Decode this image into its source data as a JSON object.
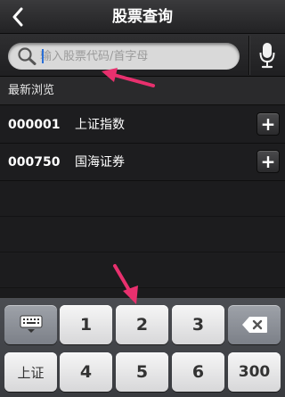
{
  "header": {
    "title": "股票查询",
    "back_icon": "chevron-left-icon"
  },
  "search": {
    "placeholder": "输入股票代码/首字母",
    "value": "",
    "search_icon": "magnifier-icon",
    "voice_icon": "microphone-icon"
  },
  "recent": {
    "section_label": "最新浏览",
    "items": [
      {
        "code": "000001",
        "name": "上证指数",
        "action_label": "+"
      },
      {
        "code": "000750",
        "name": "国海证券",
        "action_label": "+"
      }
    ]
  },
  "keyboard": {
    "row1": {
      "hide_key_icon": "keyboard-hide-icon",
      "k1": "1",
      "k2": "2",
      "k3": "3",
      "backspace_icon": "backspace-icon"
    },
    "row2": {
      "market_key": "上证",
      "k4": "4",
      "k5": "5",
      "k6": "6",
      "k300": "300"
    }
  },
  "colors": {
    "annotation_arrow": "#e8306e",
    "header_bg": "#2d2d2f",
    "key_light": "#e6e6e8",
    "key_dark": "#8b8f96"
  }
}
